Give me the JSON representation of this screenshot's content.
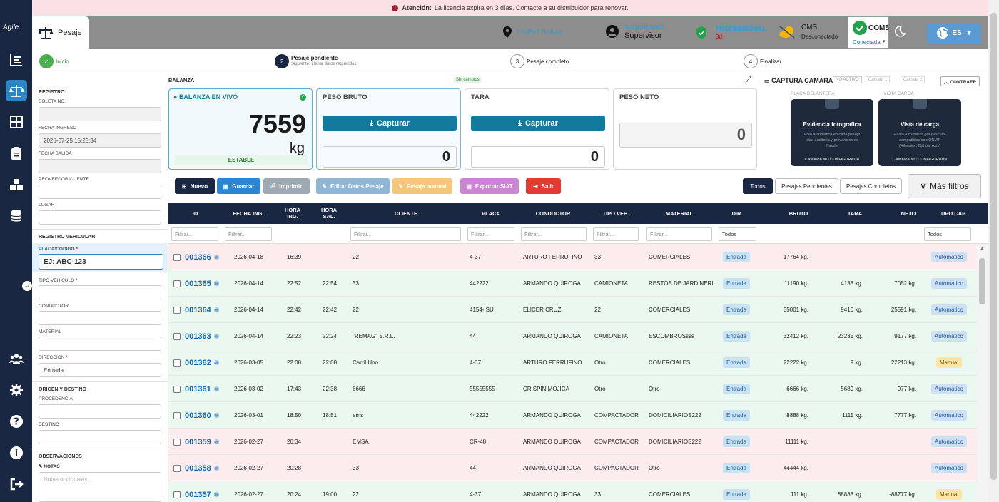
{
  "sidebar": {
    "logo": "Agile"
  },
  "banner": {
    "label": "Atención:",
    "text": "La licencia expira en 3 días. Contacte a su distribuidor para renovar."
  },
  "header": {
    "tab": "Pesaje",
    "location": "La Paz Bolivia",
    "user_name": "supervisor1",
    "user_role": "Supervisor",
    "plan": "PROFESSIONAL",
    "plan_days": "3d",
    "cms_title": "CMS",
    "cms_status": "Desconectado",
    "com_title": "COM5",
    "com_status": "Conectada",
    "lang": "ES"
  },
  "stepper": {
    "s1": "Inicio",
    "s2_num": "2",
    "s2": "Pesaje pendiente",
    "s2_sub": "Siguiente: Llenar datos requeridos",
    "s3_num": "3",
    "s3": "Pesaje completo",
    "s4_num": "4",
    "s4": "Finalizar"
  },
  "form": {
    "registro": "REGISTRO",
    "boleta": "BOLETA NO.",
    "fecha_ingreso": "FECHA INGRESO",
    "fecha_ingreso_val": "2026-07-25 15:25:34",
    "fecha_salida": "FECHA SALIDA",
    "proveedor": "PROVEEDOR/CLIENTE",
    "lugar": "LUGAR",
    "registro_vehicular": "REGISTRO VEHICULAR",
    "placa": "PLACA/CODIGO",
    "placa_placeholder": "EJ: ABC-123",
    "tipo_vehiculo": "TIPO VEHÍCULO",
    "conductor": "CONDUCTOR",
    "material": "MATERIAL",
    "direccion": "DIRECCION",
    "direccion_val": "Entrada",
    "origen": "ORIGEN Y DESTINO",
    "procedencia": "PROCEDENCIA",
    "destino": "DESTINO",
    "observaciones": "OBSERVACIONES",
    "notas": "NOTAS",
    "notas_placeholder": "Notas opcionales..."
  },
  "balanza": {
    "title": "BALANZA",
    "sin_cambios": "Sin cambios",
    "live_title": "BALANZA EN VIVO",
    "live_value": "7559",
    "unit": "kg",
    "estable": "ESTABLE",
    "bruto_title": "PESO BRUTO",
    "tara_title": "TARA",
    "neto_title": "PESO NETO",
    "capturar": "Capturar",
    "bruto_val": "0",
    "tara_val": "0",
    "neto_val": "0"
  },
  "camara": {
    "title": "CAPTURA CAMARA",
    "no_activo": "NO ACTIVO",
    "cam1": "Camara 1",
    "cam2": "Camara 2",
    "contraer": "CONTRAER",
    "placa_delantera": "PLACA DELANTERA",
    "vista_carga": "VISTA CARGA",
    "t1_title": "Evidencia fotografica",
    "t1_text": "Foto automatica en cada pesaje para auditoria y prevencion de fraude",
    "t1_foot": "CAMARA NO CONFIGURADA",
    "t2_title": "Vista de carga",
    "t2_text": "Hasta 4 camaras por bascula, compatibles con ONVIF (Hikvision, Dahua, Axis)",
    "t2_foot": "CAMARA NO CONFIGURADA"
  },
  "toolbar": {
    "nuevo": "Nuevo",
    "guardar": "Guardar",
    "imprimir": "Imprimir",
    "editar": "Editar Datos Pesaje",
    "manual": "Pesaje manual",
    "exportar": "Exportar SIAT",
    "salir": "Salir",
    "todos": "Todos",
    "pendientes": "Pesajes Pendientes",
    "completos": "Pesajes Completos",
    "mas_filtros": "Más filtros"
  },
  "table": {
    "headers": [
      "ID",
      "FECHA ING.",
      "HORA ING.",
      "HORA SAL.",
      "CLIENTE",
      "PLACA",
      "CONDUCTOR",
      "TIPO VEH.",
      "MATERIAL",
      "DIR.",
      "BRUTO",
      "TARA",
      "NETO",
      "TIPO CAP."
    ],
    "filter_placeholder": "Filtrar...",
    "filter_all": "Todos",
    "rows": [
      {
        "id": "001366",
        "fecha": "2026-04-18",
        "hing": "16:39",
        "hsal": "",
        "cliente": "22",
        "placa": "4-37",
        "conductor": "ARTURO FERRUFINO",
        "tipo": "33",
        "material": "COMERCIALES",
        "dir": "Entrada",
        "bruto": "17764 kg.",
        "tara": "",
        "neto": "",
        "cap": "Automático"
      },
      {
        "id": "001365",
        "fecha": "2026-04-14",
        "hing": "22:52",
        "hsal": "22:54",
        "cliente": "33",
        "placa": "442222",
        "conductor": "ARMANDO QUIROGA",
        "tipo": "CAMIONETA",
        "material": "RESTOS DE JARDINERI...",
        "dir": "Entrada",
        "bruto": "11190 kg.",
        "tara": "4138 kg.",
        "neto": "7052 kg.",
        "cap": "Automático"
      },
      {
        "id": "001364",
        "fecha": "2026-04-14",
        "hing": "22:42",
        "hsal": "22:42",
        "cliente": "22",
        "placa": "4154-ISU",
        "conductor": "ELICER CRUZ",
        "tipo": "22",
        "material": "COMERCIALES",
        "dir": "Entrada",
        "bruto": "35001 kg.",
        "tara": "9410 kg.",
        "neto": "25591 kg.",
        "cap": "Automático"
      },
      {
        "id": "001363",
        "fecha": "2026-04-14",
        "hing": "22:23",
        "hsal": "22:24",
        "cliente": "\"REMAG\" S.R.L.",
        "placa": "44",
        "conductor": "ARMANDO QUIROGA",
        "tipo": "CAMIONETA",
        "material": "ESCOMBROSsss",
        "dir": "Entrada",
        "bruto": "32412 kg.",
        "tara": "23235 kg.",
        "neto": "9177 kg.",
        "cap": "Automático"
      },
      {
        "id": "001362",
        "fecha": "2026-03-05",
        "hing": "22:08",
        "hsal": "22:08",
        "cliente": "Carril Uno",
        "placa": "4-37",
        "conductor": "ARTURO FERRUFINO",
        "tipo": "Otro",
        "material": "COMERCIALES",
        "dir": "Entrada",
        "bruto": "22222 kg.",
        "tara": "9 kg.",
        "neto": "22213 kg.",
        "cap": "Manual"
      },
      {
        "id": "001361",
        "fecha": "2026-03-02",
        "hing": "17:43",
        "hsal": "22:38",
        "cliente": "6666",
        "placa": "55555555",
        "conductor": "CRISPIN MOJICA",
        "tipo": "Otro",
        "material": "Otro",
        "dir": "Entrada",
        "bruto": "6666 kg.",
        "tara": "5689 kg.",
        "neto": "977 kg.",
        "cap": "Automático"
      },
      {
        "id": "001360",
        "fecha": "2026-03-01",
        "hing": "18:50",
        "hsal": "18:51",
        "cliente": "ems",
        "placa": "442222",
        "conductor": "ARMANDO QUIROGA",
        "tipo": "COMPACTADOR",
        "material": "DOMICILIARIOS222",
        "dir": "Entrada",
        "bruto": "8888 kg.",
        "tara": "1111 kg.",
        "neto": "7777 kg.",
        "cap": "Automático"
      },
      {
        "id": "001359",
        "fecha": "2026-02-27",
        "hing": "20:34",
        "hsal": "",
        "cliente": "EMSA",
        "placa": "CR-48",
        "conductor": "ARMANDO QUIROGA",
        "tipo": "COMPACTADOR",
        "material": "DOMICILIARIOS222",
        "dir": "Entrada",
        "bruto": "11111 kg.",
        "tara": "",
        "neto": "",
        "cap": "Automático"
      },
      {
        "id": "001358",
        "fecha": "2026-02-27",
        "hing": "20:28",
        "hsal": "",
        "cliente": "33",
        "placa": "44",
        "conductor": "ARMANDO QUIROGA",
        "tipo": "COMPACTADOR",
        "material": "Otro",
        "dir": "Entrada",
        "bruto": "44444 kg.",
        "tara": "",
        "neto": "",
        "cap": "Automático"
      },
      {
        "id": "001357",
        "fecha": "2026-02-27",
        "hing": "20:24",
        "hsal": "19:00",
        "cliente": "22",
        "placa": "4-37",
        "conductor": "ARMANDO QUIROGA",
        "tipo": "33",
        "material": "COMERCIALES",
        "dir": "Entrada",
        "bruto": "111 kg.",
        "tara": "88888 kg.",
        "neto": "-88777 kg.",
        "cap": "Manual"
      }
    ]
  },
  "colors": {
    "navy": "#1a2743",
    "accent": "#137a9e",
    "pending": "#fdecee",
    "complete": "#eaf8ef"
  }
}
